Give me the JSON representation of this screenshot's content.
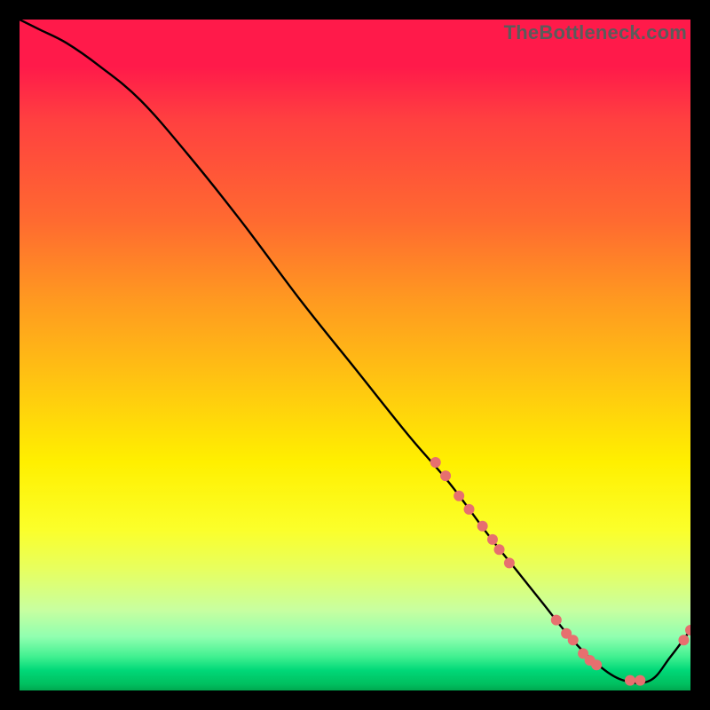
{
  "watermark": {
    "text": "TheBottleneck.com"
  },
  "chart_data": {
    "type": "line",
    "title": "",
    "xlabel": "",
    "ylabel": "",
    "xlim": [
      0,
      100
    ],
    "ylim": [
      0,
      100
    ],
    "gradient_stops": [
      {
        "pos": 0,
        "color": "#ff1a4a"
      },
      {
        "pos": 7,
        "color": "#ff1a4a"
      },
      {
        "pos": 15,
        "color": "#ff4040"
      },
      {
        "pos": 30,
        "color": "#ff6a30"
      },
      {
        "pos": 42,
        "color": "#ff9a20"
      },
      {
        "pos": 55,
        "color": "#ffc810"
      },
      {
        "pos": 66,
        "color": "#fff000"
      },
      {
        "pos": 76,
        "color": "#fbff2a"
      },
      {
        "pos": 82,
        "color": "#e7ff60"
      },
      {
        "pos": 88,
        "color": "#c8ffa0"
      },
      {
        "pos": 92,
        "color": "#90ffb0"
      },
      {
        "pos": 95,
        "color": "#40f090"
      },
      {
        "pos": 97,
        "color": "#00d878"
      },
      {
        "pos": 99,
        "color": "#00c060"
      },
      {
        "pos": 100,
        "color": "#00a850"
      }
    ],
    "series": [
      {
        "name": "bottleneck-curve",
        "color": "#000000",
        "x": [
          0,
          3,
          7,
          12,
          18,
          25,
          33,
          42,
          50,
          58,
          64,
          70,
          74,
          78,
          82,
          86,
          90,
          94,
          97,
          100
        ],
        "y": [
          100,
          98.5,
          96.5,
          93,
          88,
          80,
          70,
          58,
          48,
          38,
          31,
          23,
          18,
          13,
          8,
          4,
          1.5,
          1.5,
          5,
          9
        ]
      }
    ],
    "markers": {
      "color": "#e76f6f",
      "radius": 6,
      "points": [
        {
          "x": 62,
          "y": 34
        },
        {
          "x": 63.5,
          "y": 32
        },
        {
          "x": 65.5,
          "y": 29
        },
        {
          "x": 67,
          "y": 27
        },
        {
          "x": 69,
          "y": 24.5
        },
        {
          "x": 70.5,
          "y": 22.5
        },
        {
          "x": 71.5,
          "y": 21
        },
        {
          "x": 73,
          "y": 19
        },
        {
          "x": 80,
          "y": 10.5
        },
        {
          "x": 81.5,
          "y": 8.5
        },
        {
          "x": 82.5,
          "y": 7.5
        },
        {
          "x": 84,
          "y": 5.5
        },
        {
          "x": 85,
          "y": 4.5
        },
        {
          "x": 86,
          "y": 3.8
        },
        {
          "x": 91,
          "y": 1.5
        },
        {
          "x": 92.5,
          "y": 1.5
        },
        {
          "x": 99,
          "y": 7.5
        },
        {
          "x": 100,
          "y": 9
        }
      ]
    }
  }
}
